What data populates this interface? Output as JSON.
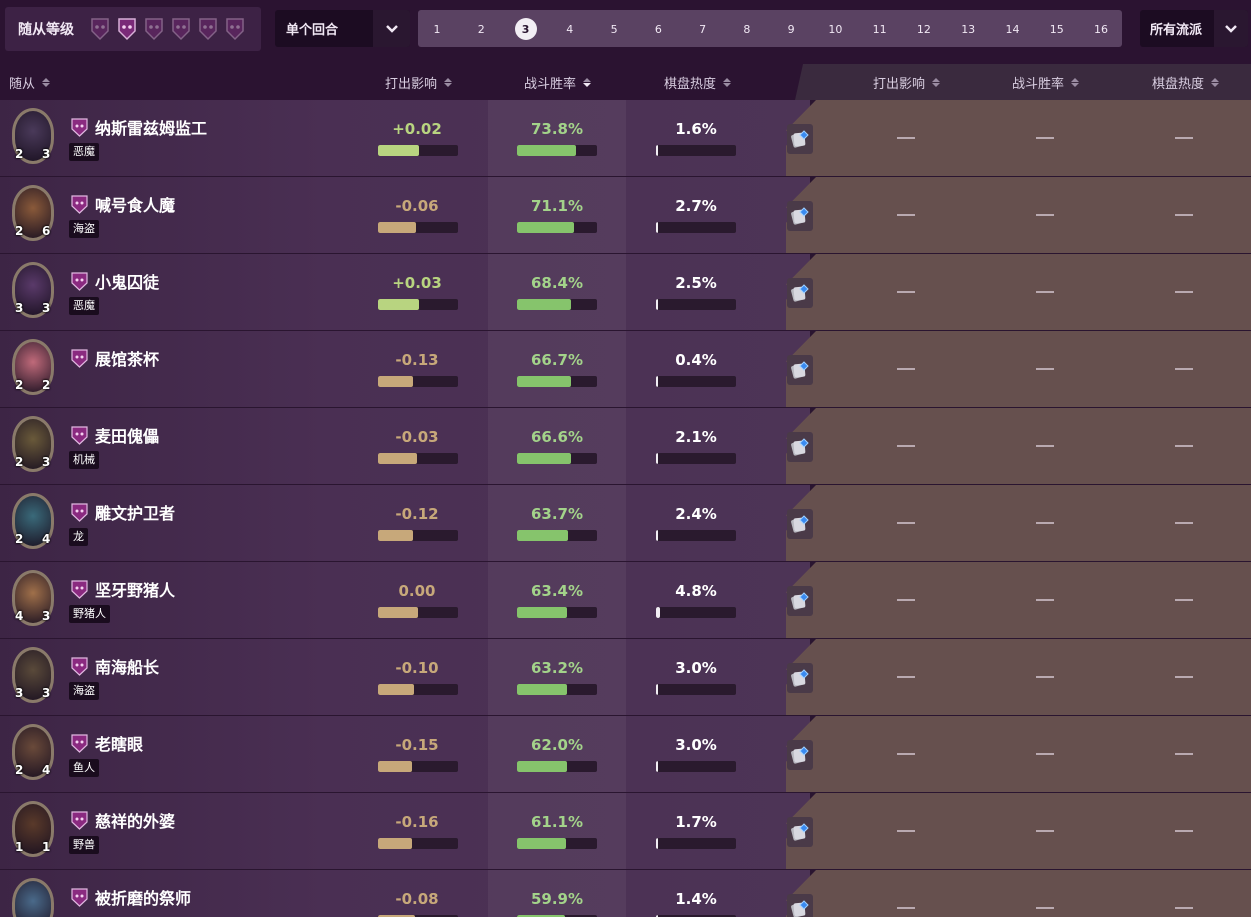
{
  "filters": {
    "tier_label": "随从等级",
    "tiers": [
      1,
      2,
      3,
      4,
      5,
      6
    ],
    "active_tier_index": 1,
    "round_mode": "单个回合",
    "rounds": [
      "1",
      "2",
      "3",
      "4",
      "5",
      "6",
      "7",
      "8",
      "9",
      "10",
      "11",
      "12",
      "13",
      "14",
      "15",
      "16"
    ],
    "active_round": "3",
    "archetype": "所有流派"
  },
  "columns": {
    "minion": "随从",
    "impact": "打出影响",
    "winrate": "战斗胜率",
    "popularity": "棋盘热度",
    "impact2": "打出影响",
    "winrate2": "战斗胜率",
    "popularity2": "棋盘热度"
  },
  "colors": {
    "positive": "#b8d480",
    "negative": "#c7a87a",
    "winrate": "#86c46c",
    "winrate_text": "#a3d38a",
    "popularity_fill": "#f2eef4"
  },
  "minions": [
    {
      "name": "纳斯雷兹姆监工",
      "type": "恶魔",
      "attack": "2",
      "health": "3",
      "impact": "+0.02",
      "impact_pct": 0.51,
      "winrate": "73.8%",
      "winrate_pct": 0.74,
      "popularity": "1.6%",
      "pop_pct": 0.016,
      "dash": "—"
    },
    {
      "name": "喊号食人魔",
      "type": "海盗",
      "attack": "2",
      "health": "6",
      "impact": "-0.06",
      "impact_pct": 0.47,
      "winrate": "71.1%",
      "winrate_pct": 0.71,
      "popularity": "2.7%",
      "pop_pct": 0.027,
      "dash": "—"
    },
    {
      "name": "小鬼囚徒",
      "type": "恶魔",
      "attack": "3",
      "health": "3",
      "impact": "+0.03",
      "impact_pct": 0.51,
      "winrate": "68.4%",
      "winrate_pct": 0.68,
      "popularity": "2.5%",
      "pop_pct": 0.025,
      "dash": "—"
    },
    {
      "name": "展馆茶杯",
      "type": "",
      "attack": "2",
      "health": "2",
      "impact": "-0.13",
      "impact_pct": 0.44,
      "winrate": "66.7%",
      "winrate_pct": 0.67,
      "popularity": "0.4%",
      "pop_pct": 0.004,
      "dash": "—"
    },
    {
      "name": "麦田傀儡",
      "type": "机械",
      "attack": "2",
      "health": "3",
      "impact": "-0.03",
      "impact_pct": 0.49,
      "winrate": "66.6%",
      "winrate_pct": 0.67,
      "popularity": "2.1%",
      "pop_pct": 0.021,
      "dash": "—"
    },
    {
      "name": "雕文护卫者",
      "type": "龙",
      "attack": "2",
      "health": "4",
      "impact": "-0.12",
      "impact_pct": 0.44,
      "winrate": "63.7%",
      "winrate_pct": 0.64,
      "popularity": "2.4%",
      "pop_pct": 0.024,
      "dash": "—"
    },
    {
      "name": "坚牙野猪人",
      "type": "野猪人",
      "attack": "4",
      "health": "3",
      "impact": "0.00",
      "impact_pct": 0.5,
      "winrate": "63.4%",
      "winrate_pct": 0.63,
      "popularity": "4.8%",
      "pop_pct": 0.048,
      "dash": "—"
    },
    {
      "name": "南海船长",
      "type": "海盗",
      "attack": "3",
      "health": "3",
      "impact": "-0.10",
      "impact_pct": 0.45,
      "winrate": "63.2%",
      "winrate_pct": 0.63,
      "popularity": "3.0%",
      "pop_pct": 0.03,
      "dash": "—"
    },
    {
      "name": "老瞎眼",
      "type": "鱼人",
      "attack": "2",
      "health": "4",
      "impact": "-0.15",
      "impact_pct": 0.43,
      "winrate": "62.0%",
      "winrate_pct": 0.62,
      "popularity": "3.0%",
      "pop_pct": 0.03,
      "dash": "—"
    },
    {
      "name": "慈祥的外婆",
      "type": "野兽",
      "attack": "1",
      "health": "1",
      "impact": "-0.16",
      "impact_pct": 0.43,
      "winrate": "61.1%",
      "winrate_pct": 0.61,
      "popularity": "1.7%",
      "pop_pct": 0.017,
      "dash": "—"
    },
    {
      "name": "被折磨的祭师",
      "type": "",
      "attack": "",
      "health": "",
      "impact": "-0.08",
      "impact_pct": 0.46,
      "winrate": "59.9%",
      "winrate_pct": 0.6,
      "popularity": "1.4%",
      "pop_pct": 0.014,
      "dash": "—"
    }
  ]
}
